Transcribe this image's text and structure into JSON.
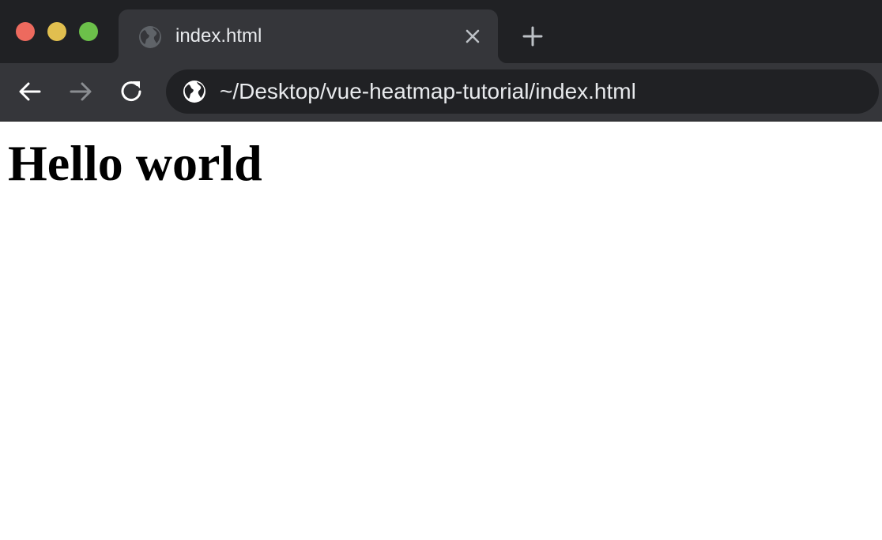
{
  "window": {
    "controls": {
      "close_color": "#ed6a5e",
      "minimize_color": "#e1bf4f",
      "maximize_color": "#6cc04a"
    }
  },
  "tab": {
    "title": "index.html",
    "favicon": "globe-icon",
    "close_icon": "close-icon",
    "active": true
  },
  "new_tab": {
    "icon": "plus-icon"
  },
  "toolbar": {
    "back_icon": "arrow-left-icon",
    "forward_icon": "arrow-right-icon",
    "forward_enabled": false,
    "reload_icon": "reload-icon"
  },
  "address_bar": {
    "icon": "globe-icon",
    "url": "~/Desktop/vue-heatmap-tutorial/index.html"
  },
  "page": {
    "heading": "Hello world"
  },
  "colors": {
    "tabstrip_bg": "#202124",
    "toolbar_bg": "#35363a",
    "omnibox_bg": "#202124",
    "text_light": "#e8eaed",
    "page_bg": "#ffffff"
  }
}
